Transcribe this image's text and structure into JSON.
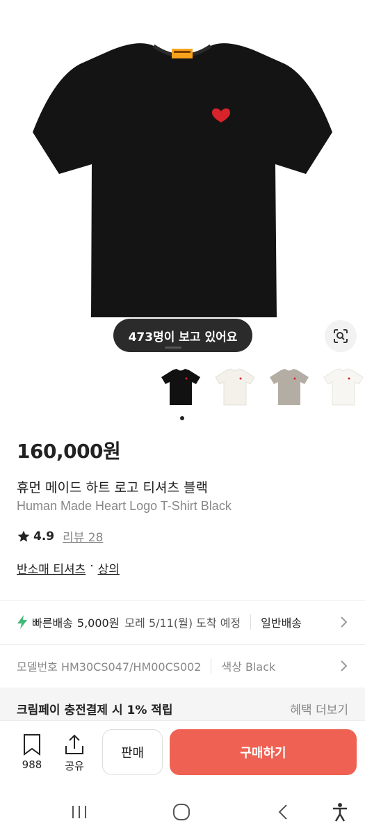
{
  "product": {
    "viewers": "473명이 보고 있어요",
    "price": "160,000원",
    "name_ko": "휴먼 메이드 하트 로고 티셔츠 블랙",
    "name_en": "Human Made Heart Logo T-Shirt Black",
    "rating": "4.9",
    "review": "리뷰 28",
    "category_1": "반소매 티셔츠",
    "category_sep": "·",
    "category_2": "상의",
    "thumbnail_colors": [
      "#111111",
      "#f3f1ea",
      "#b3ada4",
      "#f7f6f2"
    ],
    "selected_thumbnail": 1
  },
  "shipping": {
    "fast_label": "빠른배송",
    "fast_price": "5,000원",
    "fast_eta": "모레 5/11(월) 도착 예정",
    "normal_label": "일반배송"
  },
  "details": {
    "model": "모델번호 HM30CS047/HM00CS002",
    "color": "색상 Black"
  },
  "benefit": {
    "label": "크림페이 충전결제 시 1% 적립",
    "more": "혜택 더보기"
  },
  "bottom": {
    "bookmark_count": "988",
    "share_label": "공유",
    "sell_label": "판매",
    "buy_label": "구매하기"
  },
  "colors": {
    "buy_button": "#ef6253",
    "fast_shipping_icon": "#41b979",
    "label_tag": "#f7a21b",
    "heart_logo": "#d8232a"
  },
  "icons": [
    "camera-lens-icon",
    "star-icon",
    "lightning-icon",
    "chevron-right-icon",
    "bookmark-icon",
    "share-icon",
    "nav-recents-icon",
    "nav-home-icon",
    "nav-back-icon",
    "accessibility-icon"
  ]
}
